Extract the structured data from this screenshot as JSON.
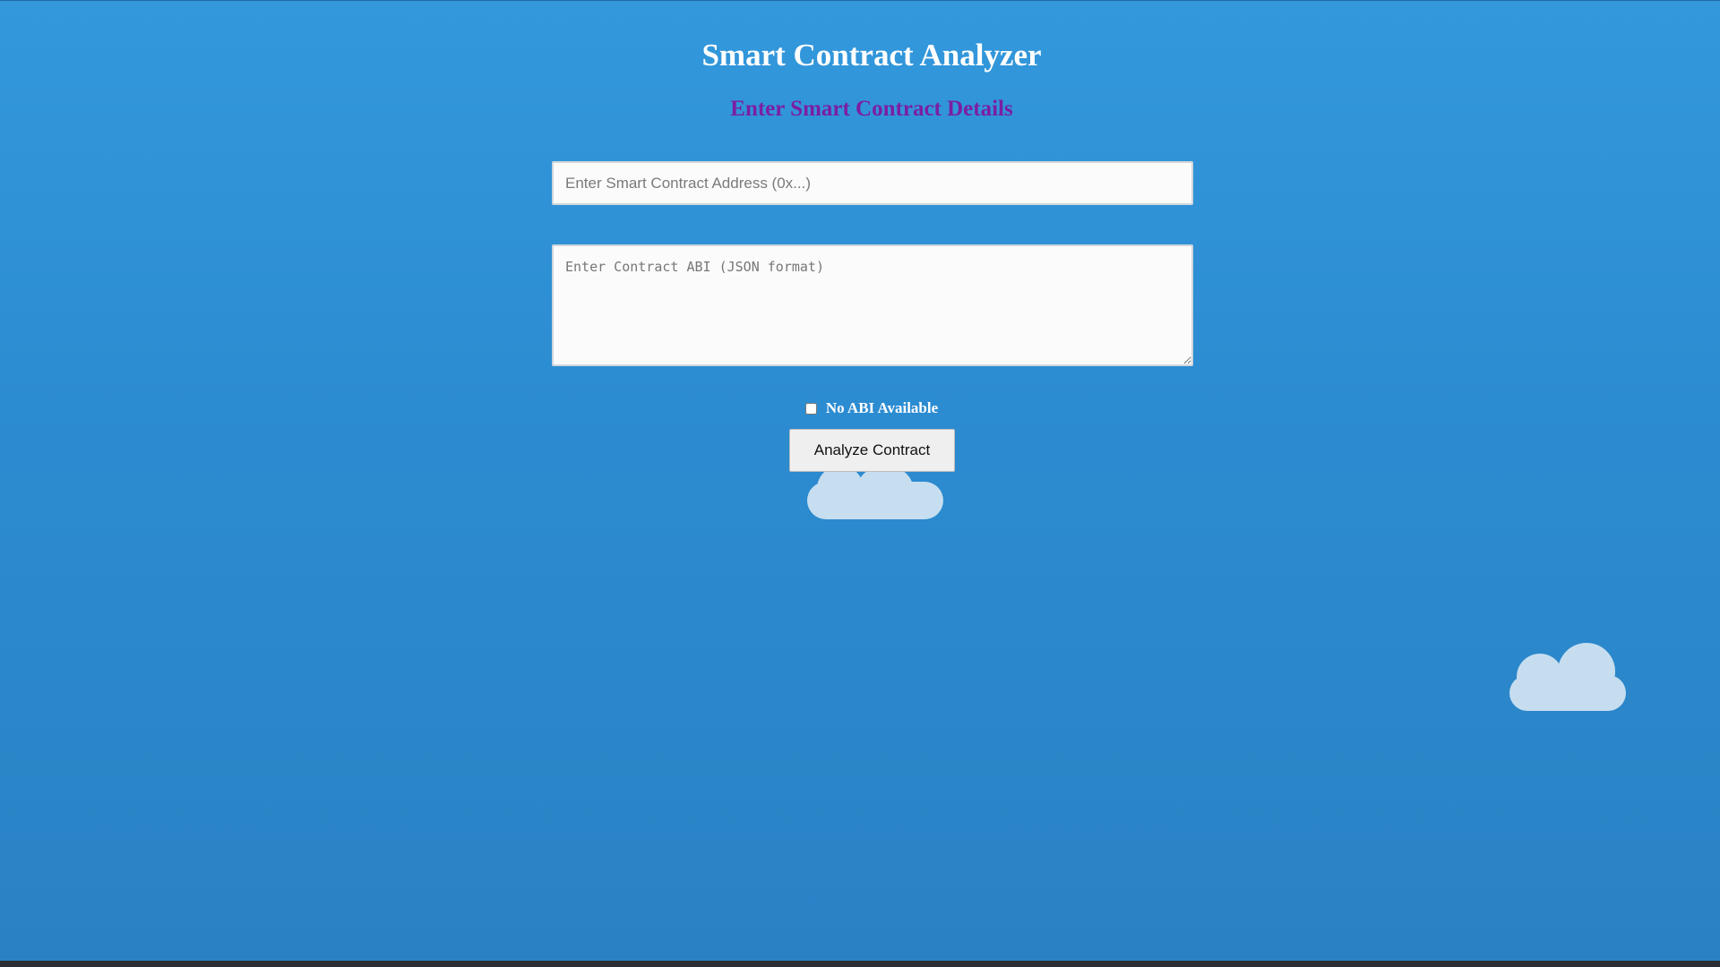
{
  "page": {
    "title": "Smart Contract Analyzer",
    "section_title": "Enter Smart Contract Details"
  },
  "form": {
    "address": {
      "placeholder": "Enter Smart Contract Address (0x...)",
      "value": ""
    },
    "abi": {
      "placeholder": "Enter Contract ABI (JSON format)",
      "value": ""
    },
    "no_abi": {
      "label": "No ABI Available",
      "checked": false
    },
    "submit_label": "Analyze Contract"
  },
  "colors": {
    "background": "#2f8fd5",
    "title": "#ffffff",
    "section_title": "#7b1fa2",
    "button_bg": "#efefef"
  }
}
